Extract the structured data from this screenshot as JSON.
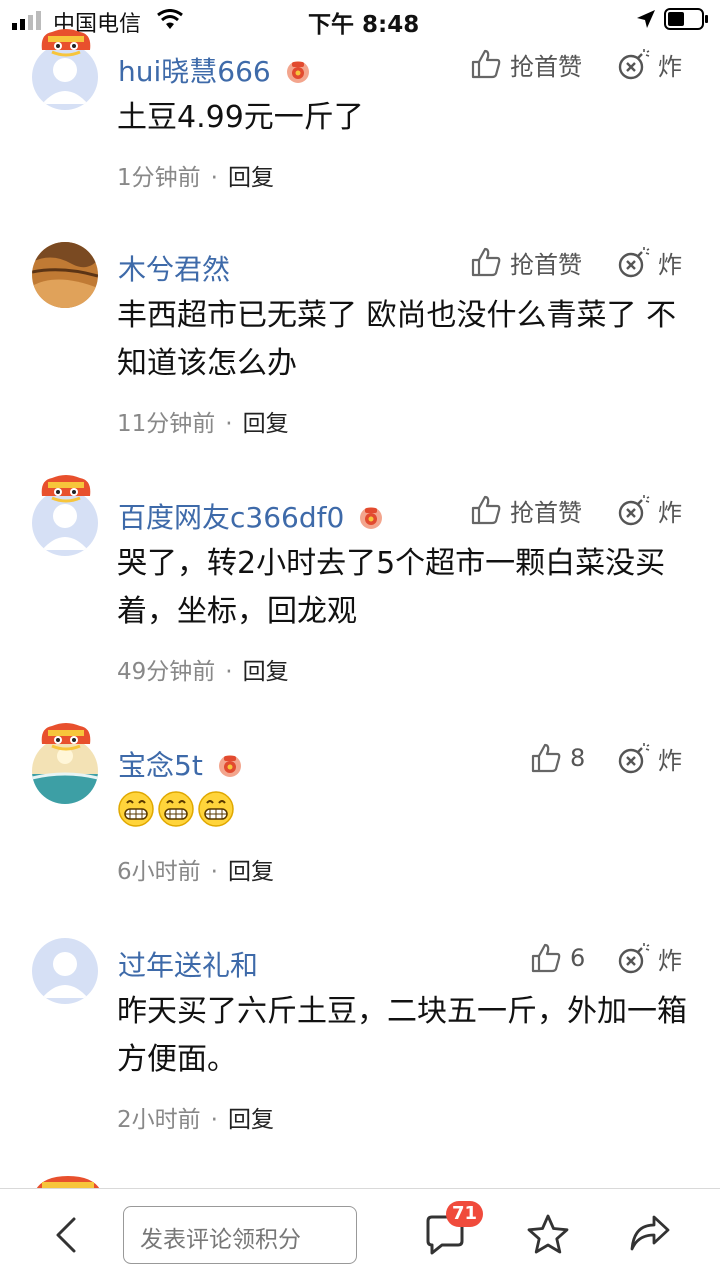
{
  "status_bar": {
    "carrier": "中国电信",
    "time": "下午 8:48"
  },
  "comments": [
    {
      "user": "hui晓慧666",
      "avatar": "default-avatar",
      "has_lion_badge": true,
      "has_redbag": true,
      "like_label": "抢首赞",
      "bomb_label": "炸",
      "text": "土豆4.99元一斤了",
      "time": "1分钟前",
      "reply": "回复"
    },
    {
      "user": "木兮君然",
      "avatar": "desert-photo-avatar",
      "has_lion_badge": false,
      "has_redbag": false,
      "like_label": "抢首赞",
      "bomb_label": "炸",
      "text": "丰西超市已无菜了  欧尚也没什么青菜了  不知道该怎么办",
      "time": "11分钟前",
      "reply": "回复"
    },
    {
      "user": "百度网友c366df0",
      "avatar": "default-avatar",
      "has_lion_badge": true,
      "has_redbag": true,
      "like_label": "抢首赞",
      "bomb_label": "炸",
      "text": "哭了，转2小时去了5个超市一颗白菜没买着，坐标，回龙观",
      "time": "49分钟前",
      "reply": "回复"
    },
    {
      "user": "宝念5t",
      "avatar": "beach-avatar",
      "has_lion_badge": true,
      "has_redbag": true,
      "like_label": "8",
      "bomb_label": "炸",
      "text": "",
      "emoji": [
        "grin-emoji",
        "grin-emoji",
        "grin-emoji"
      ],
      "time": "6小时前",
      "reply": "回复"
    },
    {
      "user": "过年送礼和",
      "avatar": "default-avatar",
      "has_lion_badge": false,
      "has_redbag": false,
      "like_label": "6",
      "bomb_label": "炸",
      "text": "昨天买了六斤土豆，二块五一斤，外加一箱方便面。",
      "time": "2小时前",
      "reply": "回复"
    }
  ],
  "bottom_bar": {
    "input_placeholder": "发表评论领积分",
    "comment_count": "71"
  },
  "colors": {
    "username": "#3e6aa9",
    "badge": "#f04b3c",
    "meta": "#888888"
  }
}
